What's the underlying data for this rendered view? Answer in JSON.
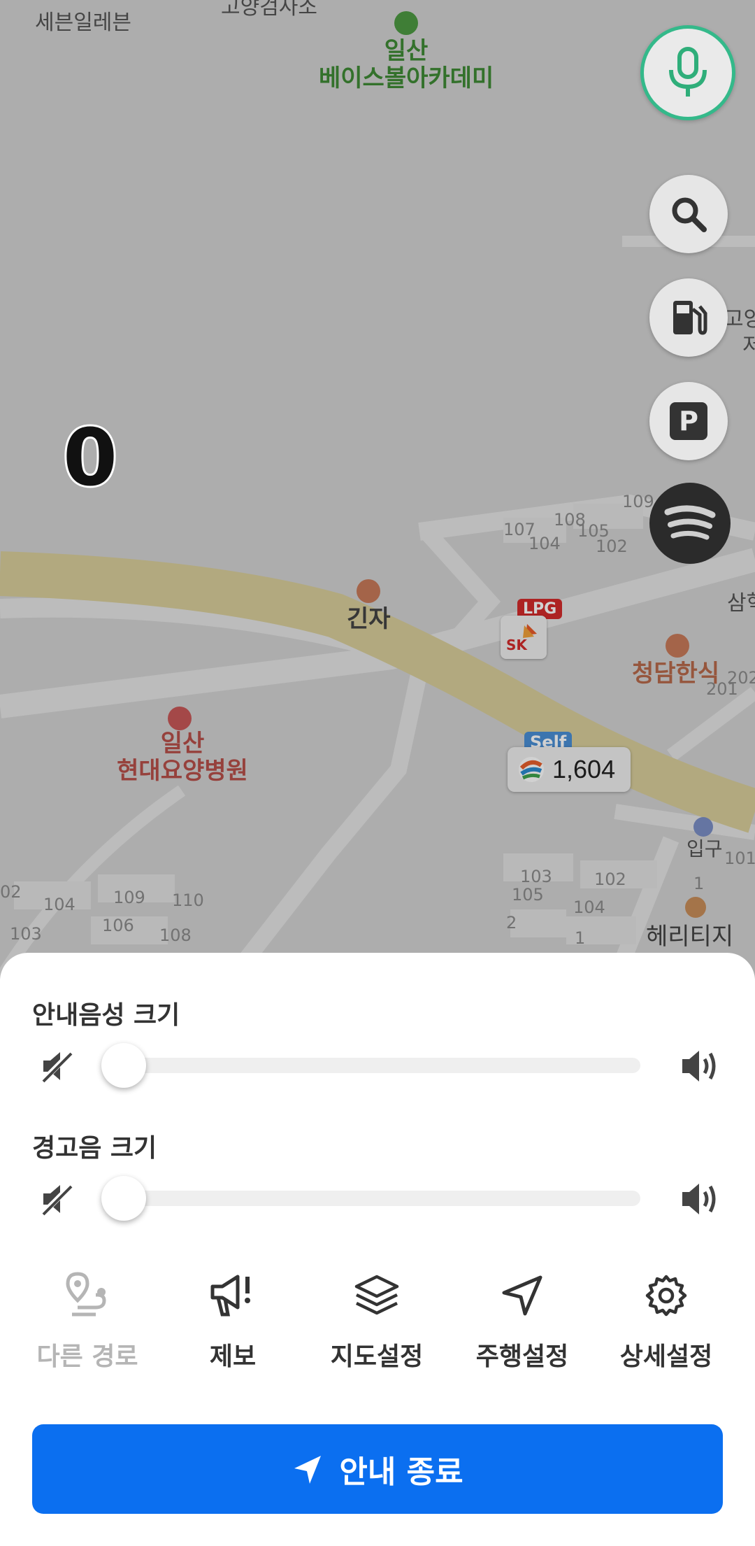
{
  "map": {
    "labels": {
      "top_left": "세븐일레븐",
      "top_center": "고양검사소",
      "academy_line1": "일산",
      "academy_line2": "베이스볼아카데미",
      "restaurant1": "긴자",
      "restaurant2": "청담한식",
      "hospital_line1": "일산",
      "hospital_line2": "현대요양병원",
      "entrance": "입구",
      "heritage": "헤리티지",
      "edge_right1": "고양",
      "edge_right2": "저",
      "edge_right3": "삼혁"
    },
    "building_numbers": [
      "109",
      "107",
      "108",
      "105",
      "104",
      "102",
      "103",
      "102",
      "105",
      "104",
      "2",
      "1",
      "1",
      "101",
      "202",
      "201",
      "104",
      "109",
      "110",
      "106",
      "103",
      "108",
      "02"
    ],
    "current_speed": "0",
    "lpg_badge": "LPG",
    "sk_label": "SK",
    "fuel_self_badge": "Self",
    "fuel_price": "1,604"
  },
  "fab": {
    "voice": "mic-icon",
    "search": "search-icon",
    "gas": "gas-station-icon",
    "parking": "parking-icon",
    "parking_letter": "P",
    "music": "spotify-icon"
  },
  "sheet": {
    "voice_volume_label": "안내음성 크기",
    "voice_volume_level": 0,
    "alert_volume_label": "경고음 크기",
    "alert_volume_level": 0,
    "menu": [
      {
        "label": "다른 경로",
        "icon": "route-icon",
        "enabled": false
      },
      {
        "label": "제보",
        "icon": "megaphone-icon",
        "enabled": true
      },
      {
        "label": "지도설정",
        "icon": "layers-icon",
        "enabled": true
      },
      {
        "label": "주행설정",
        "icon": "navigation-arrow-icon",
        "enabled": true
      },
      {
        "label": "상세설정",
        "icon": "gear-icon",
        "enabled": true
      }
    ],
    "end_button_label": "안내 종료"
  },
  "colors": {
    "accent": "#0b6ff0",
    "mic_ring": "#34b98a",
    "road_highlight": "#d9cf9c"
  }
}
